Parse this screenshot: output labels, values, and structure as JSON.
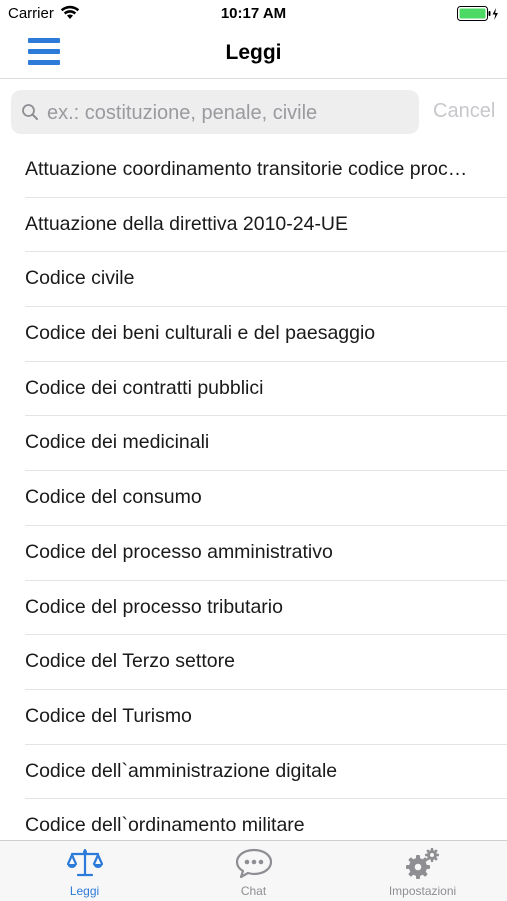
{
  "status_bar": {
    "carrier": "Carrier",
    "time": "10:17 AM"
  },
  "nav": {
    "title": "Leggi"
  },
  "search": {
    "placeholder": "ex.: costituzione, penale, civile",
    "cancel_label": "Cancel"
  },
  "list": {
    "items": [
      "Attuazione coordinamento transitorie codice proc…",
      "Attuazione della direttiva  2010-24-UE",
      "Codice civile",
      "Codice dei beni culturali e del paesaggio",
      "Codice dei contratti pubblici",
      "Codice dei medicinali",
      "Codice del consumo",
      "Codice del processo amministrativo",
      "Codice del processo tributario",
      "Codice del Terzo settore",
      "Codice del Turismo",
      "Codice dell`amministrazione digitale",
      "Codice dell`ordinamento militare"
    ]
  },
  "tabs": [
    {
      "label": "Leggi",
      "icon": "scales-icon",
      "active": true
    },
    {
      "label": "Chat",
      "icon": "chat-bubble-icon",
      "active": false
    },
    {
      "label": "Impostazioni",
      "icon": "gears-icon",
      "active": false
    }
  ],
  "colors": {
    "accent": "#2d7bd9",
    "inactive": "#8e8e93",
    "battery": "#4cd964"
  }
}
